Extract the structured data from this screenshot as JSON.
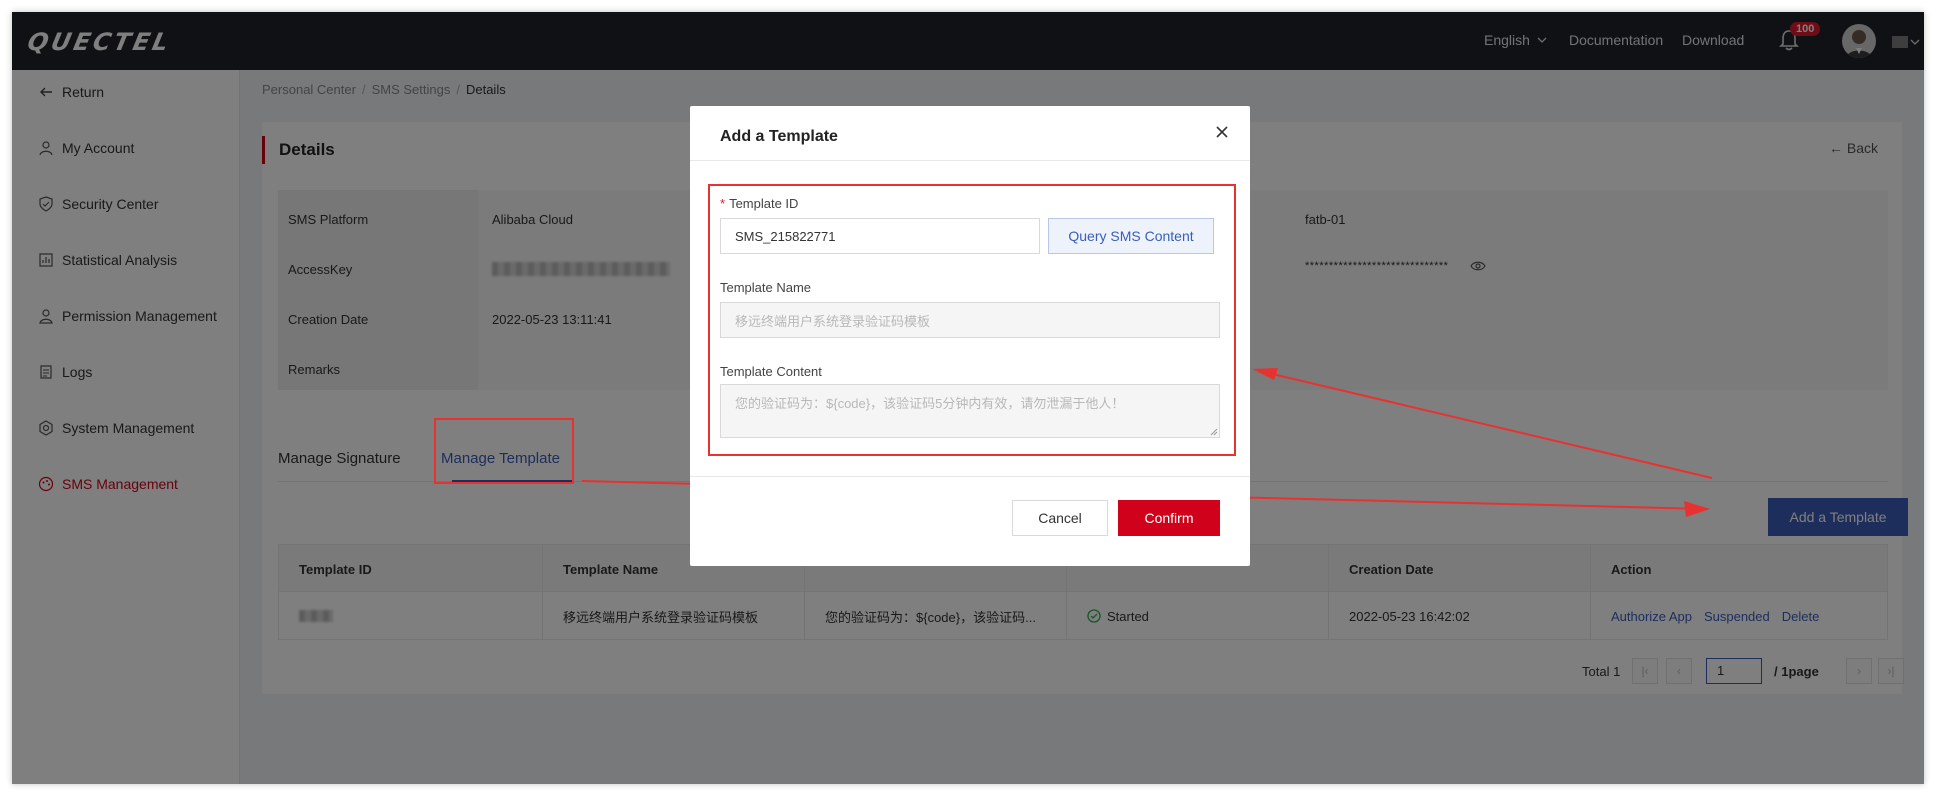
{
  "header": {
    "logo": "QUECTEL",
    "language": "English",
    "documentation": "Documentation",
    "download": "Download",
    "notification_count": "100"
  },
  "sidebar": {
    "items": [
      {
        "label": "Return",
        "icon": "arrow-left-icon"
      },
      {
        "label": "My Account",
        "icon": "user-icon"
      },
      {
        "label": "Security Center",
        "icon": "shield-icon"
      },
      {
        "label": "Statistical Analysis",
        "icon": "chart-icon"
      },
      {
        "label": "Permission Management",
        "icon": "person-key-icon"
      },
      {
        "label": "Logs",
        "icon": "document-icon"
      },
      {
        "label": "System Management",
        "icon": "gear-icon"
      },
      {
        "label": "SMS Management",
        "icon": "palette-icon",
        "active": true
      }
    ]
  },
  "breadcrumb": [
    "Personal Center",
    "SMS Settings",
    "Details"
  ],
  "details": {
    "title": "Details",
    "back": "Back",
    "rows": [
      {
        "label": "SMS Platform",
        "value": "Alibaba Cloud"
      },
      {
        "label": "AccessKey",
        "value": ""
      },
      {
        "label": "Creation Date",
        "value": "2022-05-23 13:11:41"
      },
      {
        "label": "Remarks",
        "value": ""
      }
    ],
    "right_name": "fatb-01",
    "right_secret": "******************************"
  },
  "tabs": [
    "Manage Signature",
    "Manage Template"
  ],
  "add_template_button": "Add a Template",
  "table": {
    "headers": [
      "Template ID",
      "Template Name",
      "",
      "",
      "Creation Date",
      "Action"
    ],
    "row": {
      "template_name": "移远终端用户系统登录验证码模板",
      "content": "您的验证码为：${code}，该验证码...",
      "status": "Started",
      "creation_date": "2022-05-23 16:42:02",
      "actions": [
        "Authorize App",
        "Suspended",
        "Delete"
      ]
    }
  },
  "pagination": {
    "total": "Total 1",
    "current": "1",
    "pages": "/ 1page"
  },
  "modal": {
    "title": "Add a Template",
    "template_id_label": "Template ID",
    "template_id_value": "SMS_215822771",
    "query_button": "Query SMS Content",
    "template_name_label": "Template Name",
    "template_name_value": "移远终端用户系统登录验证码模板",
    "template_content_label": "Template Content",
    "template_content_value": "您的验证码为：${code}，该验证码5分钟内有效，请勿泄漏于他人！",
    "cancel": "Cancel",
    "confirm": "Confirm"
  },
  "colors": {
    "brand_red": "#d0021b",
    "primary_blue": "#3a5db8",
    "annotation_red": "#e8322f",
    "topbar": "#1f232b"
  }
}
